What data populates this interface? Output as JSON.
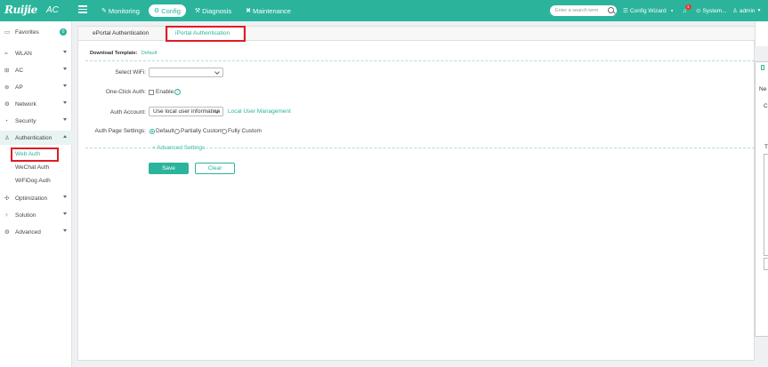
{
  "header": {
    "brand": "Ruijie",
    "brand_sub": "AC",
    "nav": [
      {
        "label": "Monitoring",
        "icon": "monitor-icon"
      },
      {
        "label": "Config",
        "icon": "config-icon"
      },
      {
        "label": "Diagnosis",
        "icon": "diagnosis-icon"
      },
      {
        "label": "Maintenance",
        "icon": "maintenance-icon"
      }
    ],
    "search_placeholder": "Enter a search term",
    "config_wizard": "Config Wizard",
    "notification_count": "1",
    "system": "System...",
    "user": "admin"
  },
  "sidebar": {
    "favorites": "Favorites",
    "favorites_count": "0",
    "items": [
      {
        "label": "WLAN"
      },
      {
        "label": "AC"
      },
      {
        "label": "AP"
      },
      {
        "label": "Network"
      },
      {
        "label": "Security"
      },
      {
        "label": "Authentication"
      },
      {
        "label": "Optimization"
      },
      {
        "label": "Solution"
      },
      {
        "label": "Advanced"
      }
    ],
    "auth_sub": [
      {
        "label": "Web Auth"
      },
      {
        "label": "WeChat Auth"
      },
      {
        "label": "WiFiDog Auth"
      }
    ]
  },
  "main": {
    "tabs": [
      {
        "label": "ePortal Authentication"
      },
      {
        "label": "iPortal Authentication"
      }
    ],
    "download_label": "Download Template:",
    "download_link": "Default",
    "select_wifi_label": "Select WiFi:",
    "select_wifi_value": "",
    "one_click_label": "One-Click Auth:",
    "one_click_enable": "Enable",
    "auth_account_label": "Auth Account:",
    "auth_account_value": "Use local user information",
    "local_user_link": "Local User Management",
    "auth_page_label": "Auth Page Settings:",
    "auth_page_options": [
      "Default",
      "Partially Custom",
      "Fully Custom"
    ],
    "advanced_settings": "Advanced Settings",
    "save": "Save",
    "clear": "Clear"
  },
  "edge": {
    "t1": "Ne",
    "t2": "C",
    "t3": "T"
  },
  "colors": {
    "brand": "#2bb49b",
    "highlight": "#e01c24"
  }
}
